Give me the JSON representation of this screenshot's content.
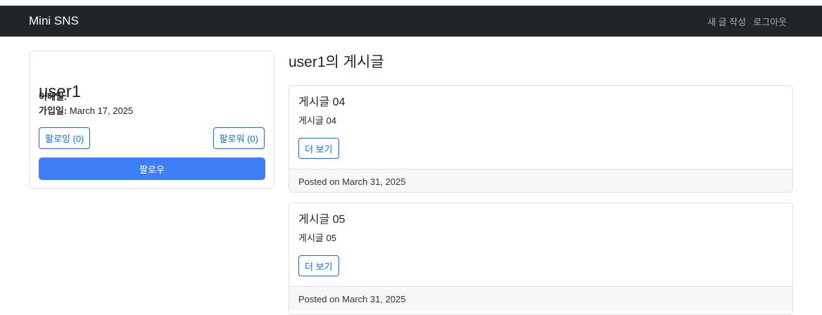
{
  "navbar": {
    "brand": "Mini SNS",
    "links": [
      "새 글 작성",
      "로그아웃"
    ]
  },
  "profile": {
    "username": "user1",
    "email_label": "이메일:",
    "email_value": "",
    "joined_label": "가입일:",
    "joined_value": " March 17, 2025",
    "following_button": "팔로잉 (0)",
    "followers_button": "팔로워 (0)",
    "follow_button": "팔로우"
  },
  "posts_section": {
    "heading": "user1의 게시글",
    "posts": [
      {
        "title": "게시글 04",
        "body": "게시글 04",
        "more_button": "더 보기",
        "footer": "Posted on March 31, 2025"
      },
      {
        "title": "게시글 05",
        "body": "게시글 05",
        "more_button": "더 보기",
        "footer": "Posted on March 31, 2025"
      }
    ]
  },
  "colors": {
    "navbar_bg": "#212529",
    "primary": "#0d6efd",
    "follow_button_bg": "#3f7ef6"
  }
}
